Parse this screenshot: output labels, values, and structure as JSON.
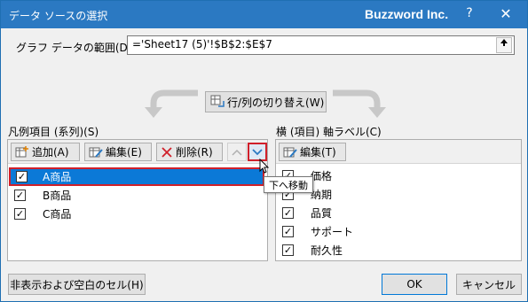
{
  "window": {
    "title": "データ ソースの選択",
    "brand": "Buzzword Inc.",
    "help": "?",
    "close": "✕"
  },
  "range": {
    "label": "グラフ データの範囲(D):",
    "value": "='Sheet17 (5)'!$B$2:$E$7"
  },
  "switch_button": {
    "label": "行/列の切り替え(W)"
  },
  "series": {
    "heading": "凡例項目 (系列)(S)",
    "add_label": "追加(A)",
    "edit_label": "編集(E)",
    "delete_label": "削除(R)",
    "items": [
      {
        "label": "A商品",
        "checked": true,
        "selected": true
      },
      {
        "label": "B商品",
        "checked": true,
        "selected": false
      },
      {
        "label": "C商品",
        "checked": true,
        "selected": false
      }
    ]
  },
  "axis": {
    "heading": "横 (項目) 軸ラベル(C)",
    "edit_label": "編集(T)",
    "items": [
      {
        "label": "価格",
        "checked": true
      },
      {
        "label": "納期",
        "checked": true
      },
      {
        "label": "品質",
        "checked": true
      },
      {
        "label": "サポート",
        "checked": true
      },
      {
        "label": "耐久性",
        "checked": true
      }
    ]
  },
  "tooltip": {
    "text": "下へ移動"
  },
  "footer": {
    "hidden_cells_label": "非表示および空白のセル(H)",
    "ok_label": "OK",
    "cancel_label": "キャンセル"
  },
  "colors": {
    "titlebar": "#2b79c2",
    "selection": "#0b79d7",
    "highlight_border": "#d0202a"
  }
}
